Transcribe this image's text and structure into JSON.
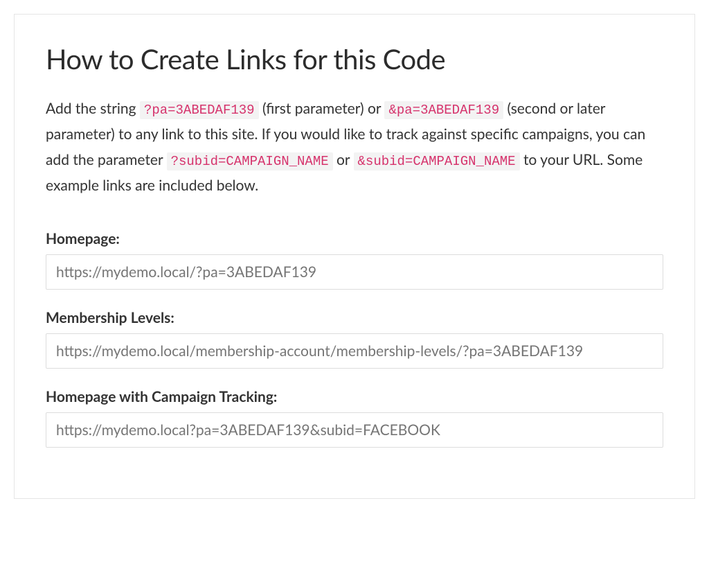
{
  "heading": "How to Create Links for this Code",
  "intro": {
    "part1": "Add the string ",
    "code1": "?pa=3ABEDAF139",
    "part2": " (first parameter) or ",
    "code2": "&pa=3ABEDAF139",
    "part3": " (second or later parameter) to any link to this site. If you would like to track against specific campaigns, you can add the parameter ",
    "code3": "?subid=CAMPAIGN_NAME",
    "part4": " or ",
    "code4": "&subid=CAMPAIGN_NAME",
    "part5": " to your URL. Some example links are included below."
  },
  "examples": {
    "homepage": {
      "label": "Homepage:",
      "url": "https://mydemo.local/?pa=3ABEDAF139"
    },
    "membership": {
      "label": "Membership Levels:",
      "url": "https://mydemo.local/membership-account/membership-levels/?pa=3ABEDAF139"
    },
    "campaign": {
      "label": "Homepage with Campaign Tracking:",
      "url": "https://mydemo.local?pa=3ABEDAF139&subid=FACEBOOK"
    }
  }
}
